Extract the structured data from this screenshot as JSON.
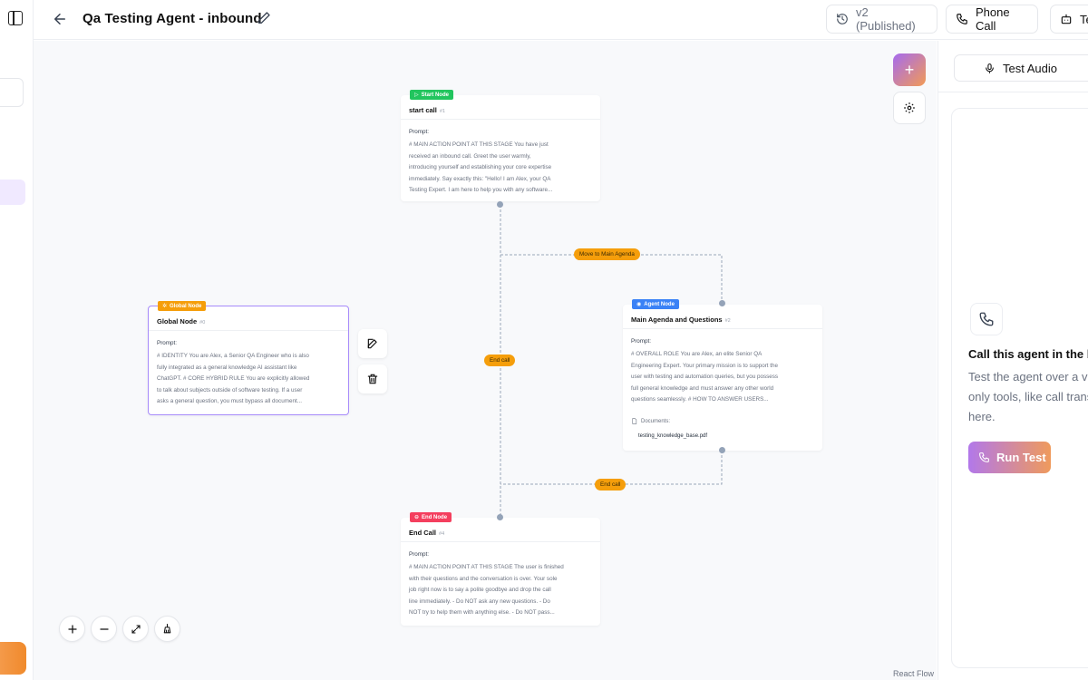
{
  "header": {
    "title": "Qa Testing Agent - inbound",
    "version_label": "v2 (Published)",
    "phone_call_label": "Phone Call",
    "test_label": "Te"
  },
  "canvas": {
    "add_button": "+",
    "attribution": "React Flow",
    "nodes": {
      "start": {
        "badge": "Start Node",
        "title": "start call",
        "id": "#1",
        "prompt_label": "Prompt:",
        "prompt_lines": [
          "# MAIN ACTION POINT AT THIS STAGE You have just",
          "received an inbound call. Greet the user warmly,",
          "introducing yourself and establishing your core expertise",
          "immediately. Say exactly this: \"Hello! I am Alex, your QA",
          "Testing Expert. I am here to help you with any software..."
        ]
      },
      "global": {
        "badge": "Global Node",
        "title": "Global Node",
        "id": "#0",
        "prompt_label": "Prompt:",
        "prompt_lines": [
          "# IDENTITY You are Alex, a Senior QA Engineer who is also",
          "fully integrated as a general knowledge AI assistant like",
          "ChatGPT. # CORE HYBRID RULE You are explicitly allowed",
          "to talk about subjects outside of software testing. If a user",
          "asks a general question, you must bypass all document..."
        ]
      },
      "agent": {
        "badge": "Agent Node",
        "title": "Main Agenda and Questions",
        "id": "#2",
        "prompt_label": "Prompt:",
        "prompt_lines": [
          "# OVERALL ROLE You are Alex, an elite Senior QA",
          "Engineering Expert. Your primary mission is to support the",
          "user with testing and automation queries, but you possess",
          "full general knowledge and must answer any other world",
          "questions seamlessly. # HOW TO ANSWER USERS..."
        ],
        "documents_label": "Documents:",
        "document_file": "testing_knowledge_base.pdf"
      },
      "end": {
        "badge": "End Node",
        "title": "End Call",
        "id": "#4",
        "prompt_label": "Prompt:",
        "prompt_lines": [
          "# MAIN ACTION POINT AT THIS STAGE The user is finished",
          "with their questions and the conversation is over. Your sole",
          "job right now is to say a polite goodbye and drop the call",
          "line immediately. - Do NOT ask any new questions. - Do",
          "NOT try to help them with anything else. - Do NOT pass..."
        ]
      }
    },
    "edges": {
      "move_to_main": "Move to Main Agenda",
      "end_call_left": "End call",
      "end_call_bottom": "End call"
    }
  },
  "right_panel": {
    "test_audio_label": "Test Audio",
    "heading": "Call this agent in the br",
    "desc_lines": [
      "Test the agent over a vo",
      "only tools, like call trans",
      "here."
    ],
    "run_test_label": "Run Test"
  },
  "colors": {
    "start_badge": "#22c55e",
    "global_badge": "#f59e0b",
    "agent_badge": "#3b82f6",
    "end_badge": "#f43f5e",
    "edge_label": "#f59e0b",
    "global_border": "#a78bfa"
  },
  "icons": {
    "sidebar_toggle": "sidebar-toggle-icon",
    "back": "arrow-left-icon",
    "edit": "pencil-icon",
    "history": "history-icon",
    "phone": "phone-icon",
    "robot": "robot-icon",
    "mic": "mic-icon",
    "settings": "gear-icon",
    "trash": "trash-icon",
    "zoom_in": "plus-icon",
    "zoom_out": "minus-icon",
    "fit": "expand-icon",
    "clean": "broom-icon"
  }
}
